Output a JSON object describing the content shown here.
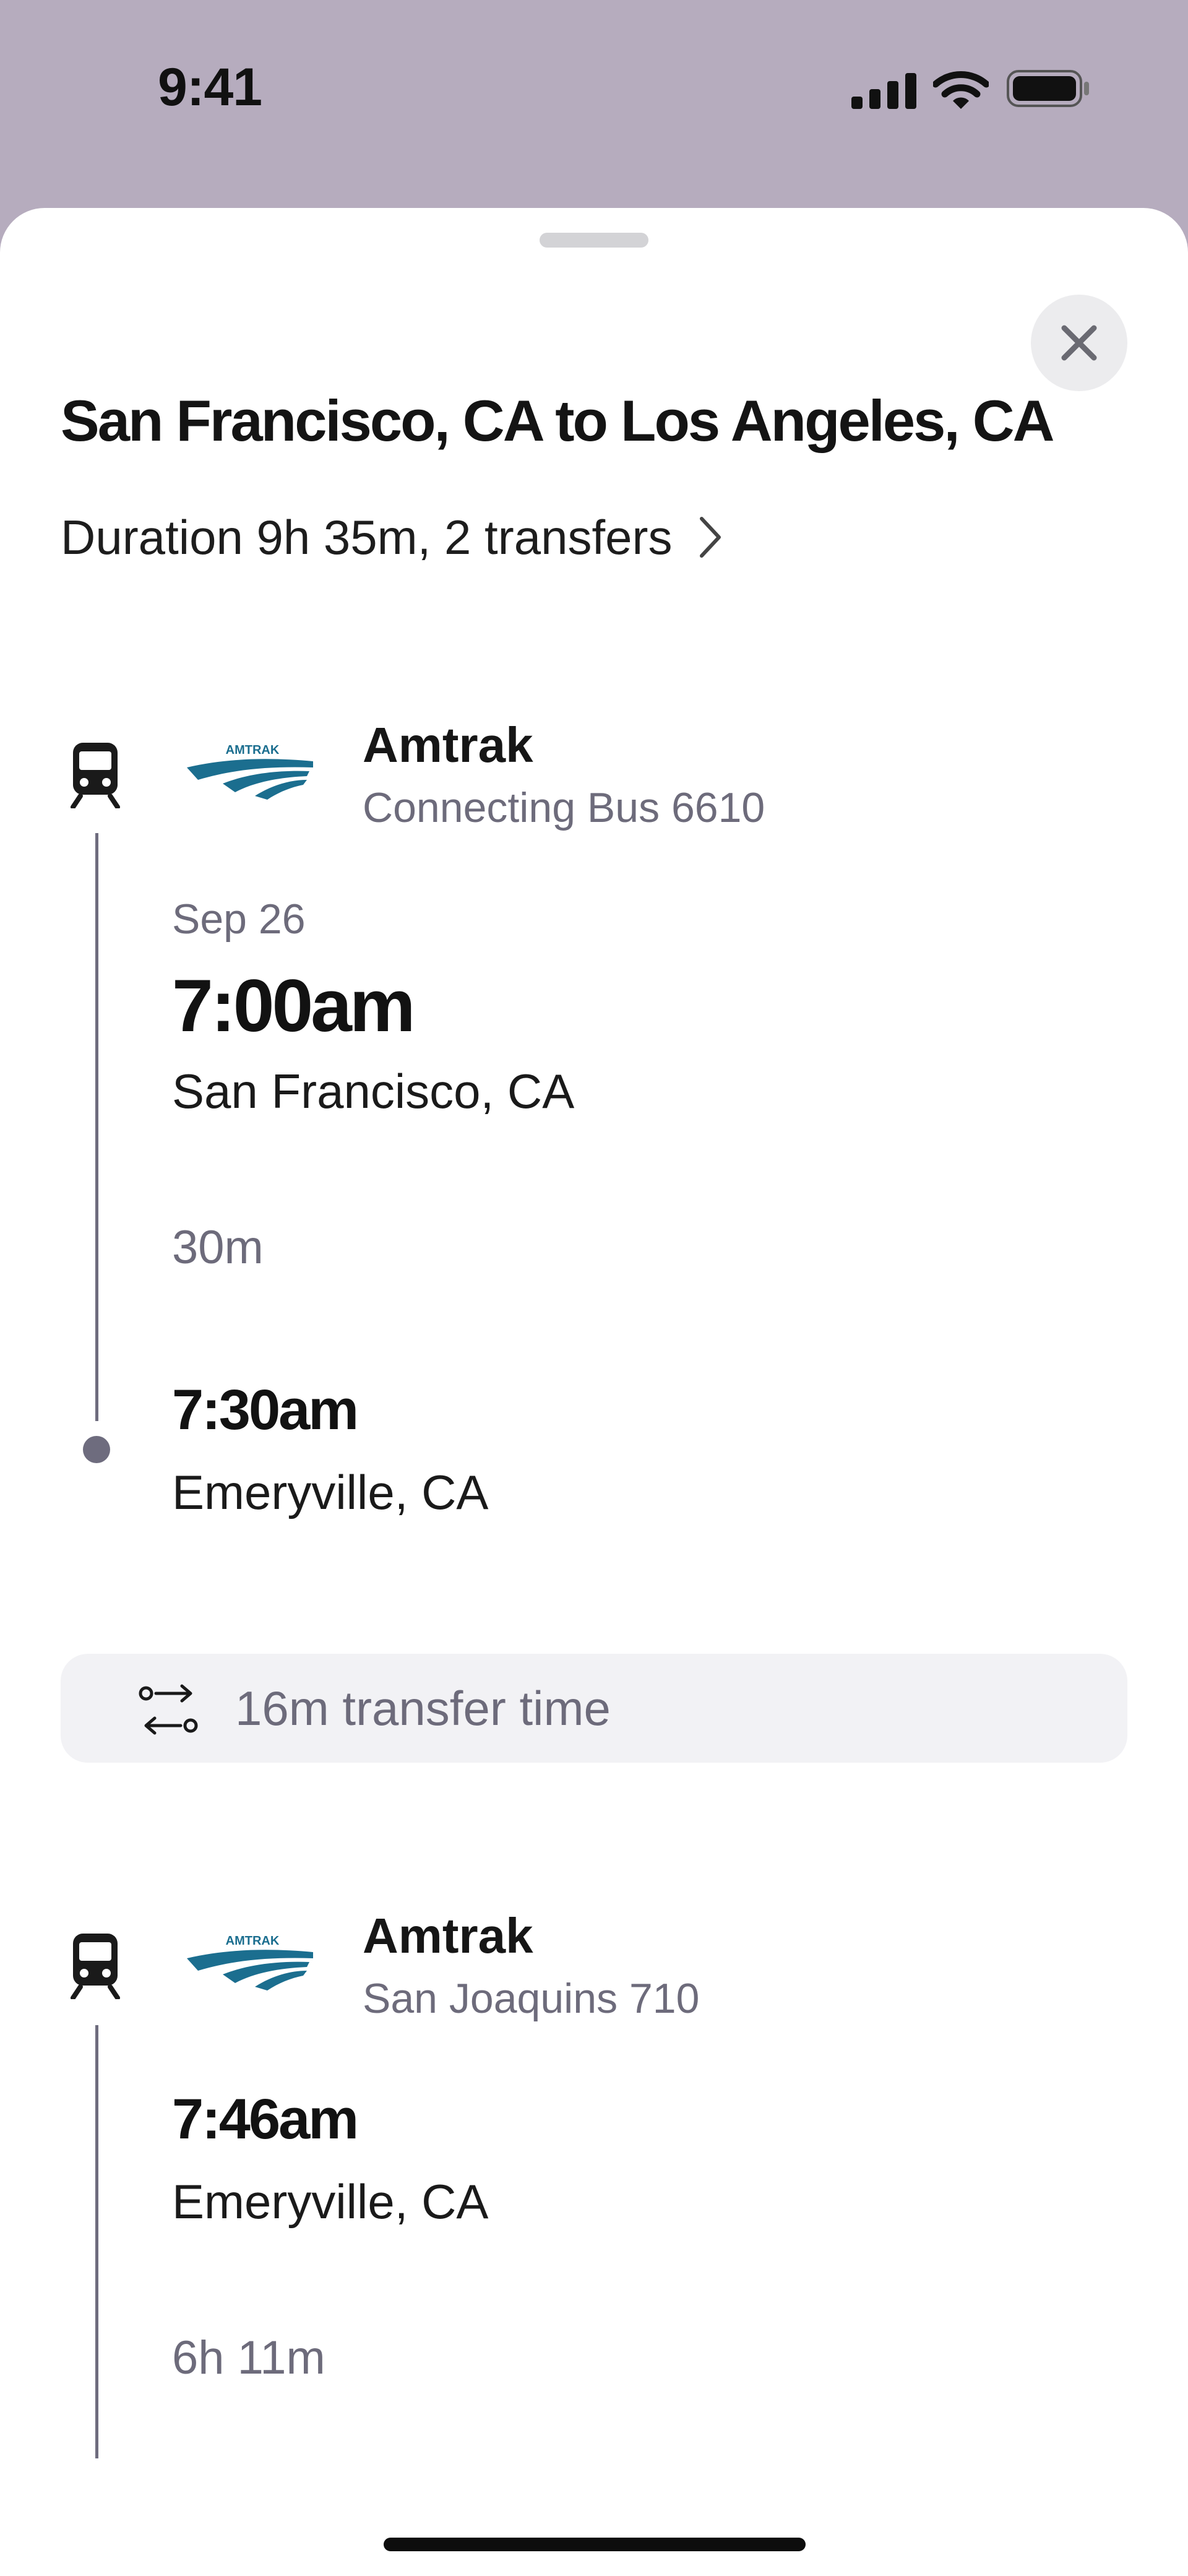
{
  "status_bar": {
    "time": "9:41"
  },
  "sheet": {
    "title": "San Francisco, CA to Los Angeles, CA",
    "subtitle": "Duration 9h 35m, 2 transfers"
  },
  "segments": [
    {
      "carrier": "Amtrak",
      "service": "Connecting Bus 6610",
      "logo_text": "AMTRAK",
      "date": "Sep 26",
      "depart_time": "7:00am",
      "depart_place": "San Francisco, CA",
      "duration": "30m",
      "arrive_time": "7:30am",
      "arrive_place": "Emeryville, CA"
    },
    {
      "carrier": "Amtrak",
      "service": "San Joaquins 710",
      "logo_text": "AMTRAK",
      "depart_time": "7:46am",
      "depart_place": "Emeryville, CA",
      "duration": "6h 11m"
    }
  ],
  "transfer": {
    "text": "16m transfer time",
    "icon": "transfer-arrows-icon"
  },
  "icons": {
    "close": "close-icon",
    "chevron": "chevron-right-icon",
    "train": "train-icon"
  },
  "colors": {
    "backdrop": "#b6acbe",
    "secondary_text": "#6d6b7b",
    "timeline": "#6e6c7e",
    "amtrak_logo": "#1b6e8f",
    "transfer_bg": "#f2f2f5"
  }
}
